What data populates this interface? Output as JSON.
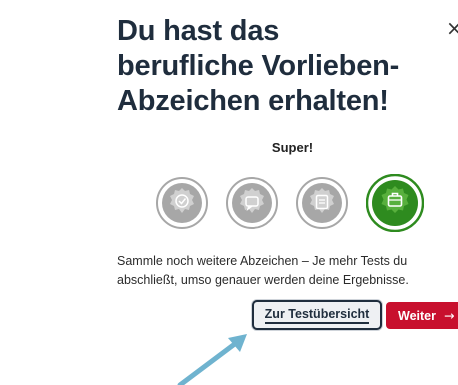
{
  "dialog": {
    "close_glyph": "×",
    "title": "Du hast das berufliche Vorlieben-Abzeichen erhalten!",
    "praise": "Super!",
    "description": "Sammle noch weitere Abzeichen – Je mehr Tests du abschließt, umso genauer werden deine Ergebnisse.",
    "badges": [
      {
        "name": "badge-1",
        "state": "locked",
        "color": "#a7a7a7"
      },
      {
        "name": "badge-2",
        "state": "locked",
        "color": "#a7a7a7"
      },
      {
        "name": "badge-3",
        "state": "locked",
        "color": "#a7a7a7"
      },
      {
        "name": "badge-berufliche-vorlieben",
        "state": "earned",
        "color": "#2e8b1f"
      }
    ],
    "buttons": {
      "overview": "Zur Testübersicht",
      "next": "Weiter",
      "next_arrow": "→"
    }
  },
  "colors": {
    "title": "#1f2d3d",
    "accent": "#c8102e",
    "badge_earned": "#2e8b1f",
    "badge_locked": "#a7a7a7",
    "pointer_arrow": "#6fb3cf"
  }
}
